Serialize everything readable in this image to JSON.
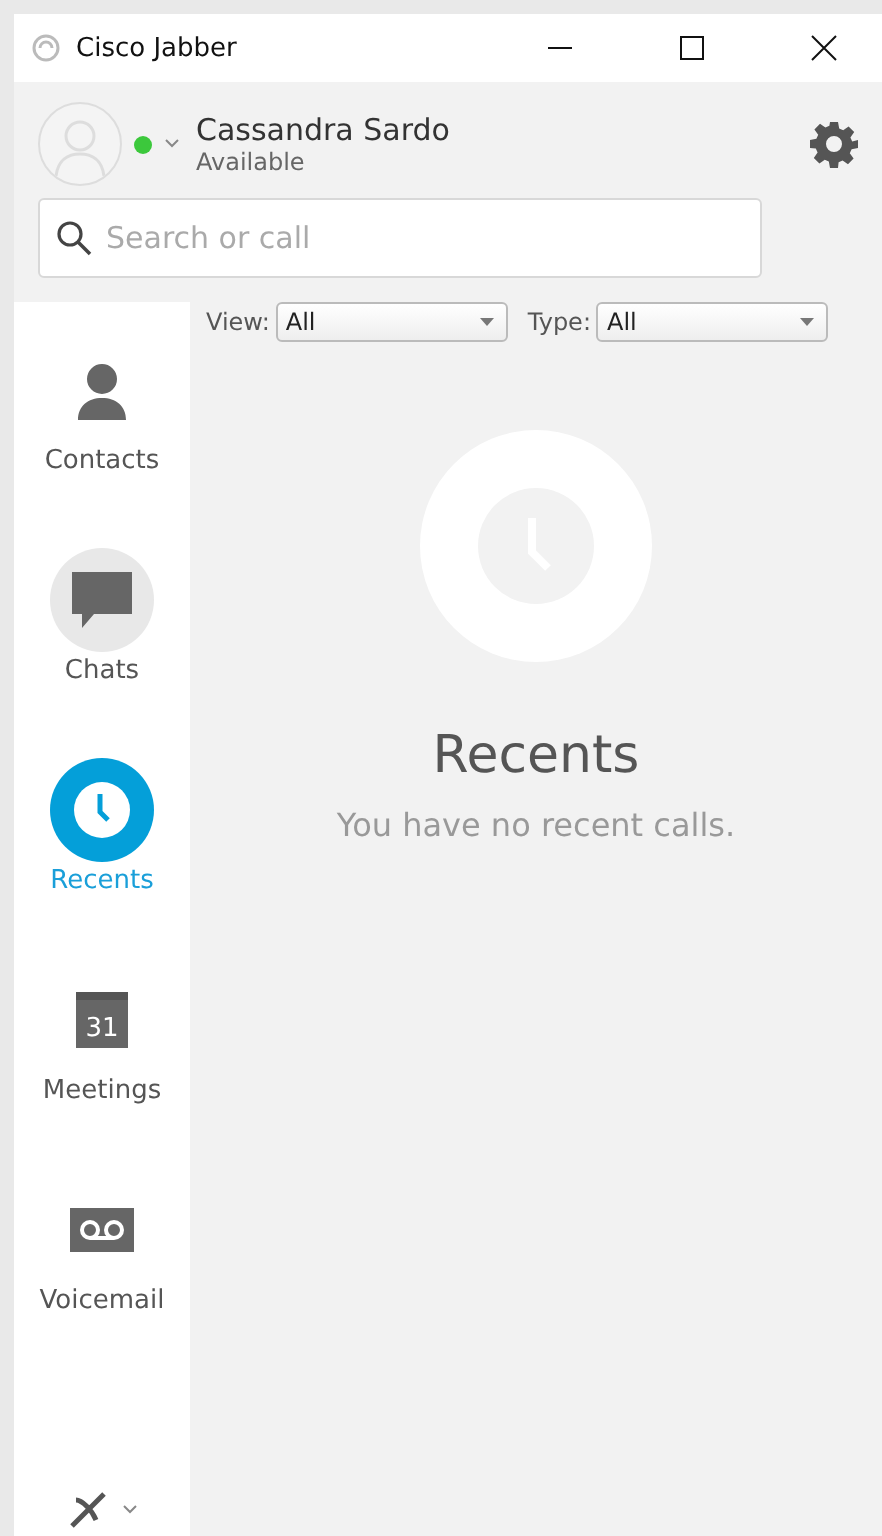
{
  "window": {
    "title": "Cisco Jabber"
  },
  "user": {
    "name": "Cassandra Sardo",
    "status": "Available",
    "color": "#3cc83c"
  },
  "search": {
    "placeholder": "Search or call"
  },
  "nav": [
    {
      "kind": "contacts",
      "label": "Contacts",
      "selected": false,
      "hovered": false
    },
    {
      "kind": "chats",
      "label": "Chats",
      "selected": false,
      "hovered": true
    },
    {
      "kind": "recents",
      "label": "Recents",
      "selected": true,
      "hovered": false
    },
    {
      "kind": "meetings",
      "label": "Meetings",
      "selected": false,
      "hovered": false,
      "icon_text": "31"
    },
    {
      "kind": "voicemail",
      "label": "Voicemail",
      "selected": false,
      "hovered": false
    }
  ],
  "filters": [
    {
      "label": "View:",
      "value": "All"
    },
    {
      "label": "Type:",
      "value": "All"
    }
  ],
  "empty_state": {
    "title": "Recents",
    "message": "You have no recent calls."
  }
}
